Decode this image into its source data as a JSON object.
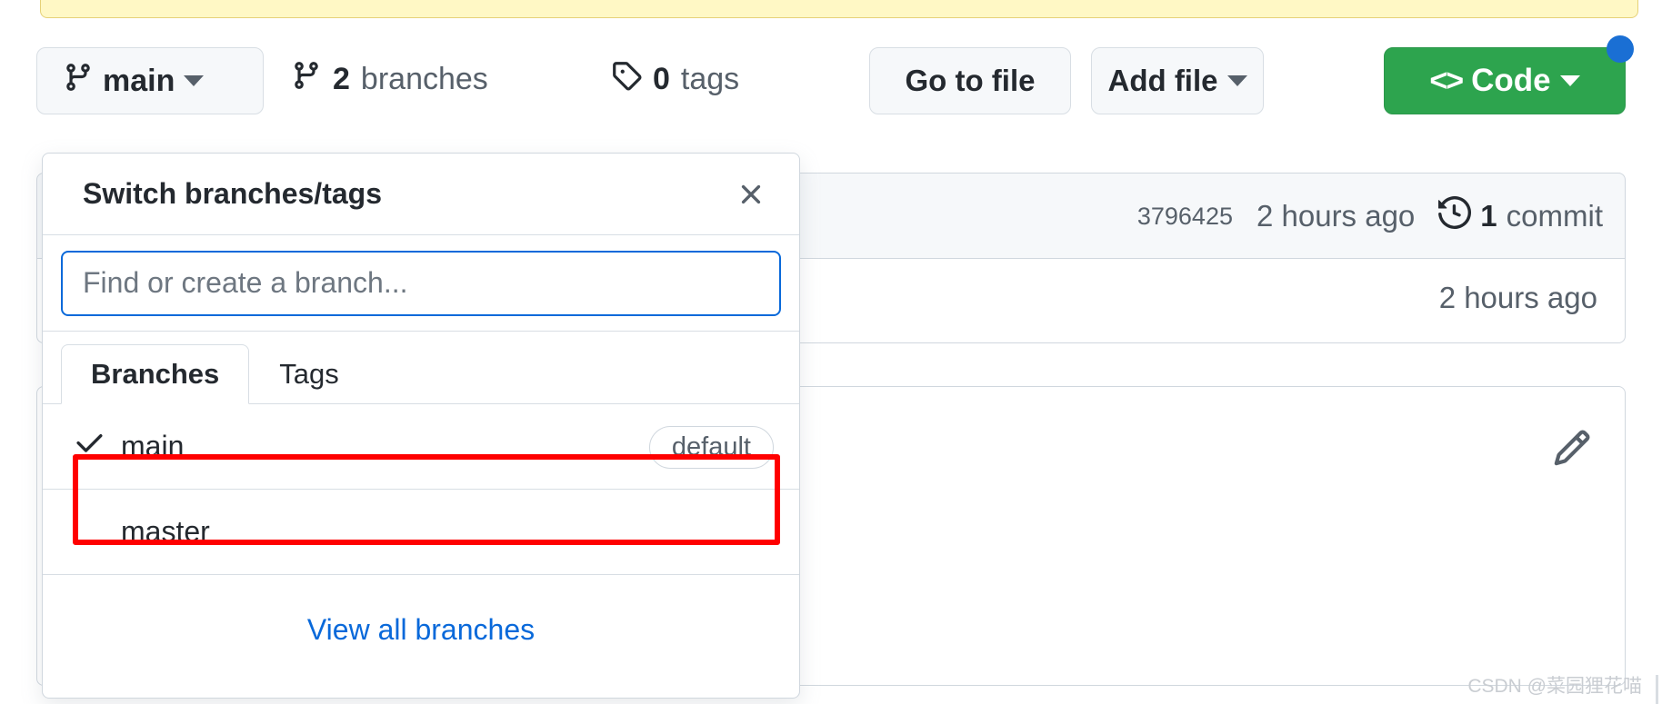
{
  "toolbar": {
    "branch_button": {
      "label": "main",
      "icon": "branch-icon",
      "caret": "chevron-down-icon"
    },
    "branches_link": {
      "count": "2",
      "label": "branches",
      "icon": "branch-icon"
    },
    "tags_link": {
      "count": "0",
      "label": "tags",
      "icon": "tag-icon"
    },
    "go_to_file": "Go to file",
    "add_file": "Add file",
    "code_button": {
      "label": "Code",
      "icon": "code-brackets-icon"
    }
  },
  "repo": {
    "commit_sha": "3796425",
    "commit_time": "2 hours ago",
    "commit_count_number": "1",
    "commit_count_label": "commit",
    "commit_history_icon": "history-clock-icon",
    "file_row_time": "2 hours ago",
    "readme_edit_icon": "pencil-icon"
  },
  "popover": {
    "title": "Switch branches/tags",
    "close_icon": "close-icon",
    "search_placeholder": "Find or create a branch...",
    "search_value": "",
    "tabs": [
      {
        "label": "Branches",
        "active": true
      },
      {
        "label": "Tags",
        "active": false
      }
    ],
    "branches": [
      {
        "name": "main",
        "selected": true,
        "check_icon": "check-icon",
        "badge": "default"
      },
      {
        "name": "master",
        "selected": false,
        "check_icon": "",
        "badge": ""
      }
    ],
    "view_all_label": "View all branches"
  },
  "annotation": {
    "highlight_color": "#ff0000"
  },
  "watermark": "CSDN @菜园狸花喵",
  "colors": {
    "code_green": "#2da44e",
    "link_blue": "#0969da",
    "notice_yellow": "#fff8c5",
    "border_gray": "#d0d7de"
  }
}
